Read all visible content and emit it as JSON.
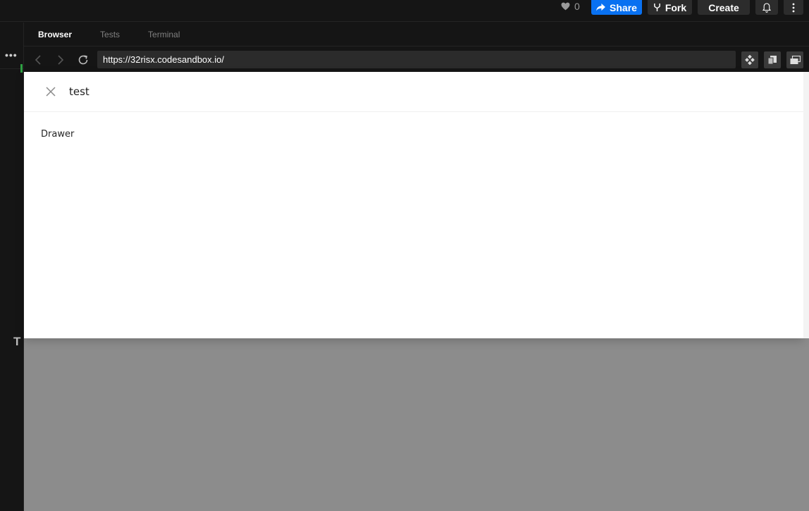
{
  "topbar": {
    "likes_count": "0",
    "share_label": "Share",
    "fork_label": "Fork",
    "create_label": "Create",
    "bell_icon": "bell-icon",
    "more_icon": "kebab-menu-icon"
  },
  "sidebar": {
    "menu_glyph": "•••",
    "cutoff_letter": "T"
  },
  "preview": {
    "tabs": [
      {
        "label": "Browser",
        "active": true
      },
      {
        "label": "Tests",
        "active": false
      },
      {
        "label": "Terminal",
        "active": false
      }
    ],
    "url": "https://32risx.codesandbox.io/"
  },
  "drawer": {
    "title": "test",
    "body_text": "Drawer"
  },
  "colors": {
    "accent": "#0971f1",
    "background": "#151515",
    "mask": "#8c8c8c"
  }
}
